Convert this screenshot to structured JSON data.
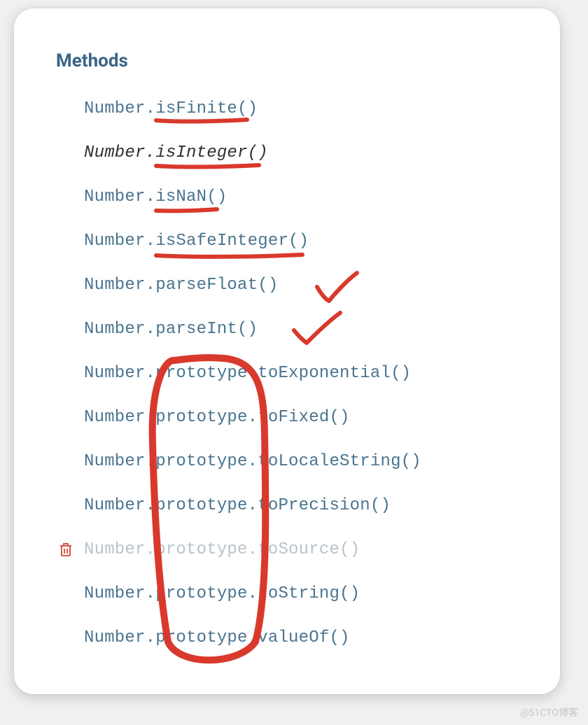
{
  "heading": "Methods",
  "items": [
    {
      "text": "Number.isFinite()",
      "italic": false,
      "deprecated": false
    },
    {
      "text": "Number.isInteger()",
      "italic": true,
      "deprecated": false
    },
    {
      "text": "Number.isNaN()",
      "italic": false,
      "deprecated": false
    },
    {
      "text": "Number.isSafeInteger()",
      "italic": false,
      "deprecated": false
    },
    {
      "text": "Number.parseFloat()",
      "italic": false,
      "deprecated": false
    },
    {
      "text": "Number.parseInt()",
      "italic": false,
      "deprecated": false
    },
    {
      "text": "Number.prototype.toExponential()",
      "italic": false,
      "deprecated": false
    },
    {
      "text": "Number.prototype.toFixed()",
      "italic": false,
      "deprecated": false
    },
    {
      "text": "Number.prototype.toLocaleString()",
      "italic": false,
      "deprecated": false
    },
    {
      "text": "Number.prototype.toPrecision()",
      "italic": false,
      "deprecated": false
    },
    {
      "text": "Number.prototype.toSource()",
      "italic": false,
      "deprecated": true
    },
    {
      "text": "Number.prototype.toString()",
      "italic": false,
      "deprecated": false
    },
    {
      "text": "Number.prototype.valueOf()",
      "italic": false,
      "deprecated": false
    }
  ],
  "watermark": "@51CTO博客",
  "annotations": {
    "underlines": [
      "isFinite",
      "isInteger",
      "isNaN",
      "isSafeInteger"
    ],
    "checkmarks_after": [
      "Number.parseFloat()",
      "Number.parseInt()"
    ],
    "circled_token": "prototype"
  }
}
